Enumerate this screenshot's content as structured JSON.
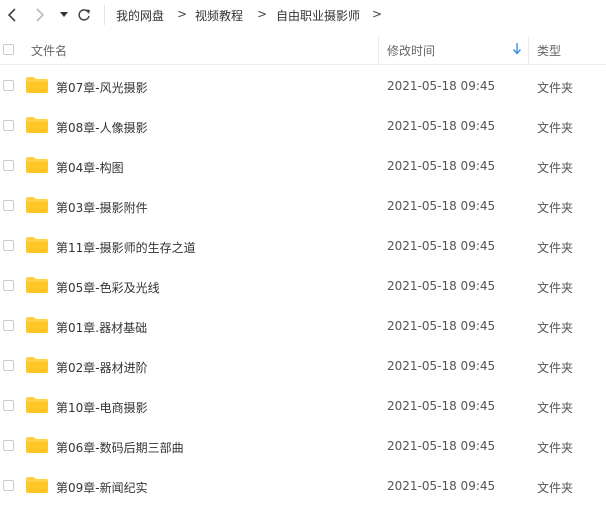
{
  "breadcrumb": [
    "我的网盘",
    "视频教程",
    "自由职业摄影师"
  ],
  "breadcrumb_separator": ">",
  "columns": {
    "name": "文件名",
    "modified": "修改时间",
    "type": "类型"
  },
  "sort": {
    "column": "modified",
    "direction": "descending"
  },
  "colors": {
    "folder": "#FFD04A",
    "sort_arrow": "#3b8ee6"
  },
  "files": [
    {
      "name": "第07章-风光摄影",
      "modified": "2021-05-18 09:45",
      "type": "文件夹"
    },
    {
      "name": "第08章-人像摄影",
      "modified": "2021-05-18 09:45",
      "type": "文件夹"
    },
    {
      "name": "第04章-构图",
      "modified": "2021-05-18 09:45",
      "type": "文件夹"
    },
    {
      "name": "第03章-摄影附件",
      "modified": "2021-05-18 09:45",
      "type": "文件夹"
    },
    {
      "name": "第11章-摄影师的生存之道",
      "modified": "2021-05-18 09:45",
      "type": "文件夹"
    },
    {
      "name": "第05章-色彩及光线",
      "modified": "2021-05-18 09:45",
      "type": "文件夹"
    },
    {
      "name": "第01章.器材基础",
      "modified": "2021-05-18 09:45",
      "type": "文件夹"
    },
    {
      "name": "第02章-器材进阶",
      "modified": "2021-05-18 09:45",
      "type": "文件夹"
    },
    {
      "name": "第10章-电商摄影",
      "modified": "2021-05-18 09:45",
      "type": "文件夹"
    },
    {
      "name": "第06章-数码后期三部曲",
      "modified": "2021-05-18 09:45",
      "type": "文件夹"
    },
    {
      "name": "第09章-新闻纪实",
      "modified": "2021-05-18 09:45",
      "type": "文件夹"
    }
  ]
}
